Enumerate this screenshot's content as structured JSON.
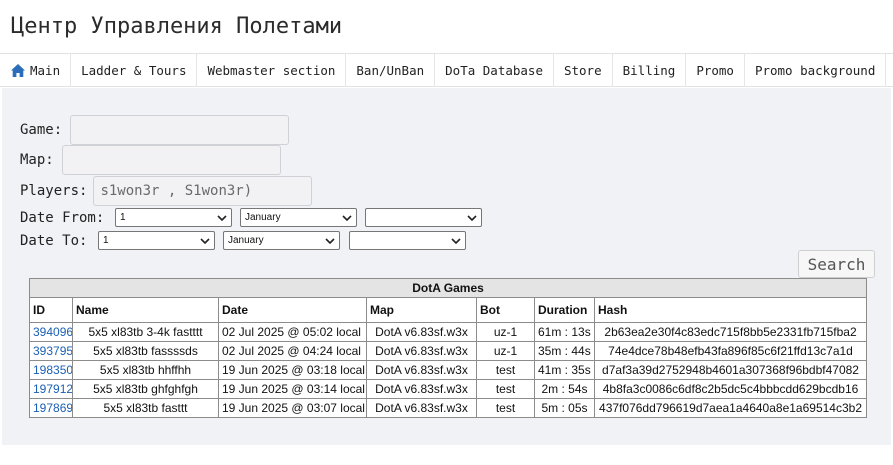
{
  "site": {
    "title": "Центр Управления Полетами"
  },
  "nav": {
    "items": [
      {
        "label": "Main",
        "icon": "home-icon"
      },
      {
        "label": "Ladder & Tours"
      },
      {
        "label": "Webmaster section"
      },
      {
        "label": "Ban/UnBan"
      },
      {
        "label": "DoTa Database"
      },
      {
        "label": "Store"
      },
      {
        "label": "Billing"
      },
      {
        "label": "Promo"
      },
      {
        "label": "Promo background"
      }
    ],
    "icon_color": "#2a6ebb"
  },
  "form": {
    "game_label": "Game:",
    "game_value": "",
    "map_label": "Map:",
    "map_value": "",
    "players_label": "Players:",
    "players_value": "s1won3r , S1won3r)",
    "date_from_label": "Date From:",
    "date_from": {
      "day": "1",
      "month": "January",
      "year": ""
    },
    "date_to_label": "Date To:",
    "date_to": {
      "day": "1",
      "month": "January",
      "year": ""
    },
    "search_label": "Search"
  },
  "table": {
    "caption": "DotA Games",
    "columns": [
      "ID",
      "Name",
      "Date",
      "Map",
      "Bot",
      "Duration",
      "Hash"
    ],
    "rows": [
      {
        "id": "394096",
        "name": "5x5 xl83tb 3-4k fastttt",
        "date": "02 Jul 2025 @ 05:02 local",
        "map": "DotA v6.83sf.w3x",
        "bot": "uz-1",
        "duration": "61m : 13s",
        "hash": "2b63ea2e30f4c83edc715f8bb5e2331fb715fba2"
      },
      {
        "id": "393795",
        "name": "5x5 xl83tb fassssds",
        "date": "02 Jul 2025 @ 04:24 local",
        "map": "DotA v6.83sf.w3x",
        "bot": "uz-1",
        "duration": "35m : 44s",
        "hash": "74e4dce78b48efb43fa896f85c6f21ffd13c7a1d"
      },
      {
        "id": "198350",
        "name": "5x5 xl83tb hhffhh",
        "date": "19 Jun 2025 @ 03:18 local",
        "map": "DotA v6.83sf.w3x",
        "bot": "test",
        "duration": "41m : 35s",
        "hash": "d7af3a39d2752948b4601a307368f96bdbf47082"
      },
      {
        "id": "197912",
        "name": "5x5 xl83tb ghfghfgh",
        "date": "19 Jun 2025 @ 03:14 local",
        "map": "DotA v6.83sf.w3x",
        "bot": "test",
        "duration": "2m : 54s",
        "hash": "4b8fa3c0086c6df8c2b5dc5c4bbbcdd629bcdb16"
      },
      {
        "id": "197869",
        "name": "5x5 xl83tb fasttt",
        "date": "19 Jun 2025 @ 03:07 local",
        "map": "DotA v6.83sf.w3x",
        "bot": "test",
        "duration": "5m : 05s",
        "hash": "437f076dd796619d7aea1a4640a8e1a69514c3b2"
      }
    ],
    "link_color": "#1a5fb4"
  }
}
